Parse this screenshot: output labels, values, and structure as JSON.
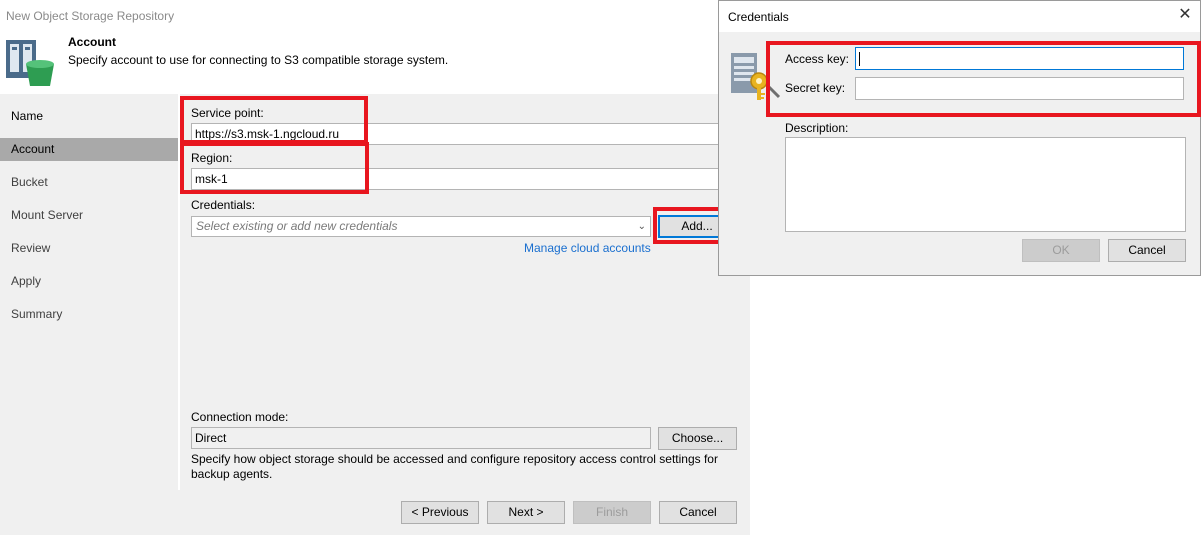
{
  "window": {
    "title": "New Object Storage Repository"
  },
  "header": {
    "title": "Account",
    "description": "Specify account to use for connecting to S3 compatible storage system."
  },
  "sidebar": {
    "items": [
      {
        "label": "Name"
      },
      {
        "label": "Account"
      },
      {
        "label": "Bucket"
      },
      {
        "label": "Mount Server"
      },
      {
        "label": "Review"
      },
      {
        "label": "Apply"
      },
      {
        "label": "Summary"
      }
    ],
    "active": "Account"
  },
  "form": {
    "service_point_label": "Service point:",
    "service_point_value": "https://s3.msk-1.ngcloud.ru",
    "region_label": "Region:",
    "region_value": "msk-1",
    "credentials_label": "Credentials:",
    "credentials_placeholder": "Select existing or add new credentials",
    "add_button": "Add...",
    "manage_link": "Manage cloud accounts",
    "connection_mode_label": "Connection mode:",
    "connection_mode_value": "Direct",
    "choose_button": "Choose...",
    "connection_mode_description": "Specify how object storage should be accessed and configure repository access control settings for backup agents."
  },
  "footer": {
    "previous": "< Previous",
    "next": "Next >",
    "finish": "Finish",
    "cancel": "Cancel"
  },
  "dialog": {
    "title": "Credentials",
    "access_key_label": "Access key:",
    "access_key_value": "",
    "secret_key_label": "Secret key:",
    "secret_key_value": "",
    "description_label": "Description:",
    "ok": "OK",
    "cancel": "Cancel"
  },
  "colors": {
    "highlight": "#e8161f",
    "link": "#1a6fcf",
    "active_nav": "#a9a9a9",
    "panel": "#f0f0f0"
  }
}
